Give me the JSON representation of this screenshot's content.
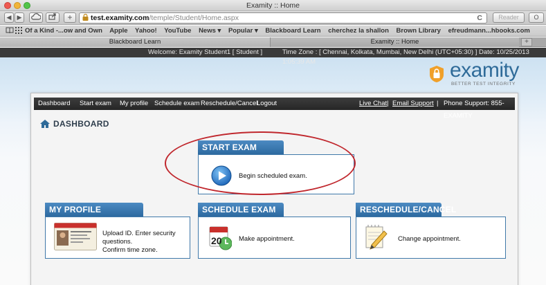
{
  "window": {
    "title": "Examity :: Home"
  },
  "toolbar": {
    "back": "◀",
    "forward": "▶",
    "url_host": "test.examity.com",
    "url_path": "/temple/Student/Home.aspx",
    "reload": "C",
    "reader": "Reader"
  },
  "bookmarks": [
    "Of a Kind -...ow and Own",
    "Apple",
    "Yahoo!",
    "YouTube",
    "News ▾",
    "Popular ▾",
    "Blackboard Learn",
    "cherchez la shallon",
    "Brown Library",
    "efreudmann...hbooks.com"
  ],
  "tabs": [
    "Blackboard Learn",
    "Examity :: Home"
  ],
  "welcome": {
    "text": "Welcome: Examity Student1 [ Student ]",
    "timezone": "Time Zone : [ Chennai, Kolkata, Mumbai, New Delhi (UTC+05:30) ]  Date: 10/25/2013 1:05:39 AM"
  },
  "logo": {
    "word": "examity",
    "tagline": "BETTER TEST INTEGRITY",
    "color": "#2f6b99",
    "badge_color": "#f0a02a"
  },
  "nav": {
    "items": [
      "Dashboard",
      "Start exam",
      "My profile",
      "Schedule exam",
      "Reschedule/Cancel",
      "Logout"
    ],
    "live_chat": "Live Chat",
    "sep1": "|",
    "email": "Email Support",
    "sep2": "|",
    "phone": "Phone Support: 855-EXAMITY"
  },
  "dashboard": {
    "title": "DASHBOARD"
  },
  "cards": {
    "start_exam": {
      "title": "START EXAM",
      "text": "Begin scheduled exam.",
      "icon": "play-icon"
    },
    "my_profile": {
      "title": "MY PROFILE",
      "text_line1": "Upload ID. Enter security questions.",
      "text_line2": "Confirm time zone.",
      "icon": "id-card-icon"
    },
    "schedule_exam": {
      "title": "SCHEDULE EXAM",
      "text": "Make appointment.",
      "icon": "calendar-icon",
      "calendar_day": "20"
    },
    "reschedule": {
      "title": "RESCHEDULE/CANCEL",
      "text": "Change appointment.",
      "icon": "notepad-pencil-icon"
    }
  },
  "colors": {
    "accent_blue": "#3f78a9",
    "nav_dark": "#2e2e2e",
    "annotation_red": "#c0272d"
  }
}
